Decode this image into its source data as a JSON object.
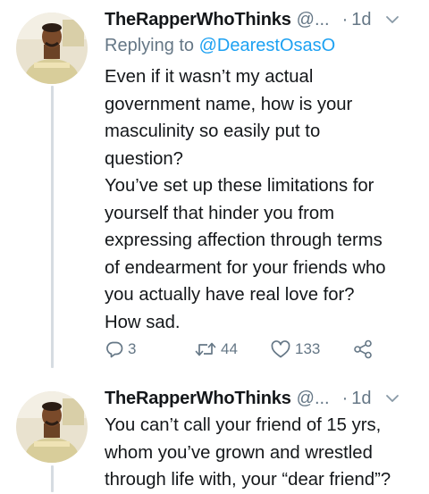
{
  "tweets": [
    {
      "author_name": "TheRapperWhoThinks",
      "author_handle": "@...",
      "separator": "·",
      "time": "1d",
      "replying_to_prefix": "Replying to",
      "replying_to_handle": "@DearestOsasO",
      "text": "Even if it wasn’t my actual\ngovernment name, how is your\nmasculinity so easily put to\nquestion?\nYou’ve set up these limitations for\nyourself that hinder you from\nexpressing affection through terms\nof endearment for your friends who\nyou actually have real love for?\nHow sad.",
      "replies": "3",
      "retweets": "44",
      "likes": "133"
    },
    {
      "author_name": "TheRapperWhoThinks",
      "author_handle": "@...",
      "separator": "·",
      "time": "1d",
      "text": "You can’t call your friend of 15 yrs,\nwhom you’ve grown and wrestled\nthrough life with, your “dear friend”?"
    }
  ],
  "icons": {
    "reply": "reply-icon",
    "retweet": "retweet-icon",
    "like": "heart-icon",
    "share": "share-icon",
    "menu": "chevron-down-icon"
  },
  "colors": {
    "text": "#14171a",
    "secondary": "#657786",
    "link": "#1da1f2",
    "thread_line": "#d6dce1"
  }
}
